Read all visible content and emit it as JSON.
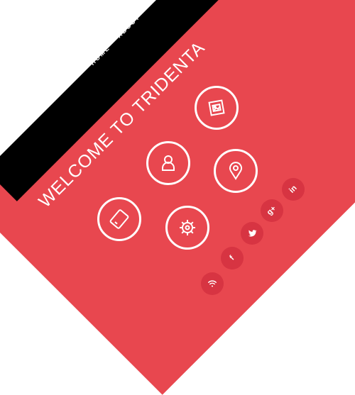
{
  "colors": {
    "band": "#e8474f",
    "navbar": "#000000",
    "text": "#ffffff",
    "social_bg": "#d73442"
  },
  "nav": {
    "items": [
      {
        "label": "HOME"
      },
      {
        "label": "ABOUT"
      }
    ]
  },
  "hero": {
    "title": "WELCOME TO TRIDENTA"
  },
  "features": [
    {
      "icon": "gallery-icon"
    },
    {
      "icon": "user-icon"
    },
    {
      "icon": "location-pin-icon"
    },
    {
      "icon": "tablet-icon"
    },
    {
      "icon": "gear-icon"
    }
  ],
  "social": {
    "items": [
      {
        "icon": "linkedin-icon",
        "label": "in"
      },
      {
        "icon": "google-plus-icon",
        "label": "g+"
      },
      {
        "icon": "twitter-icon"
      },
      {
        "icon": "facebook-icon",
        "label": "f"
      },
      {
        "icon": "rss-icon"
      }
    ]
  }
}
